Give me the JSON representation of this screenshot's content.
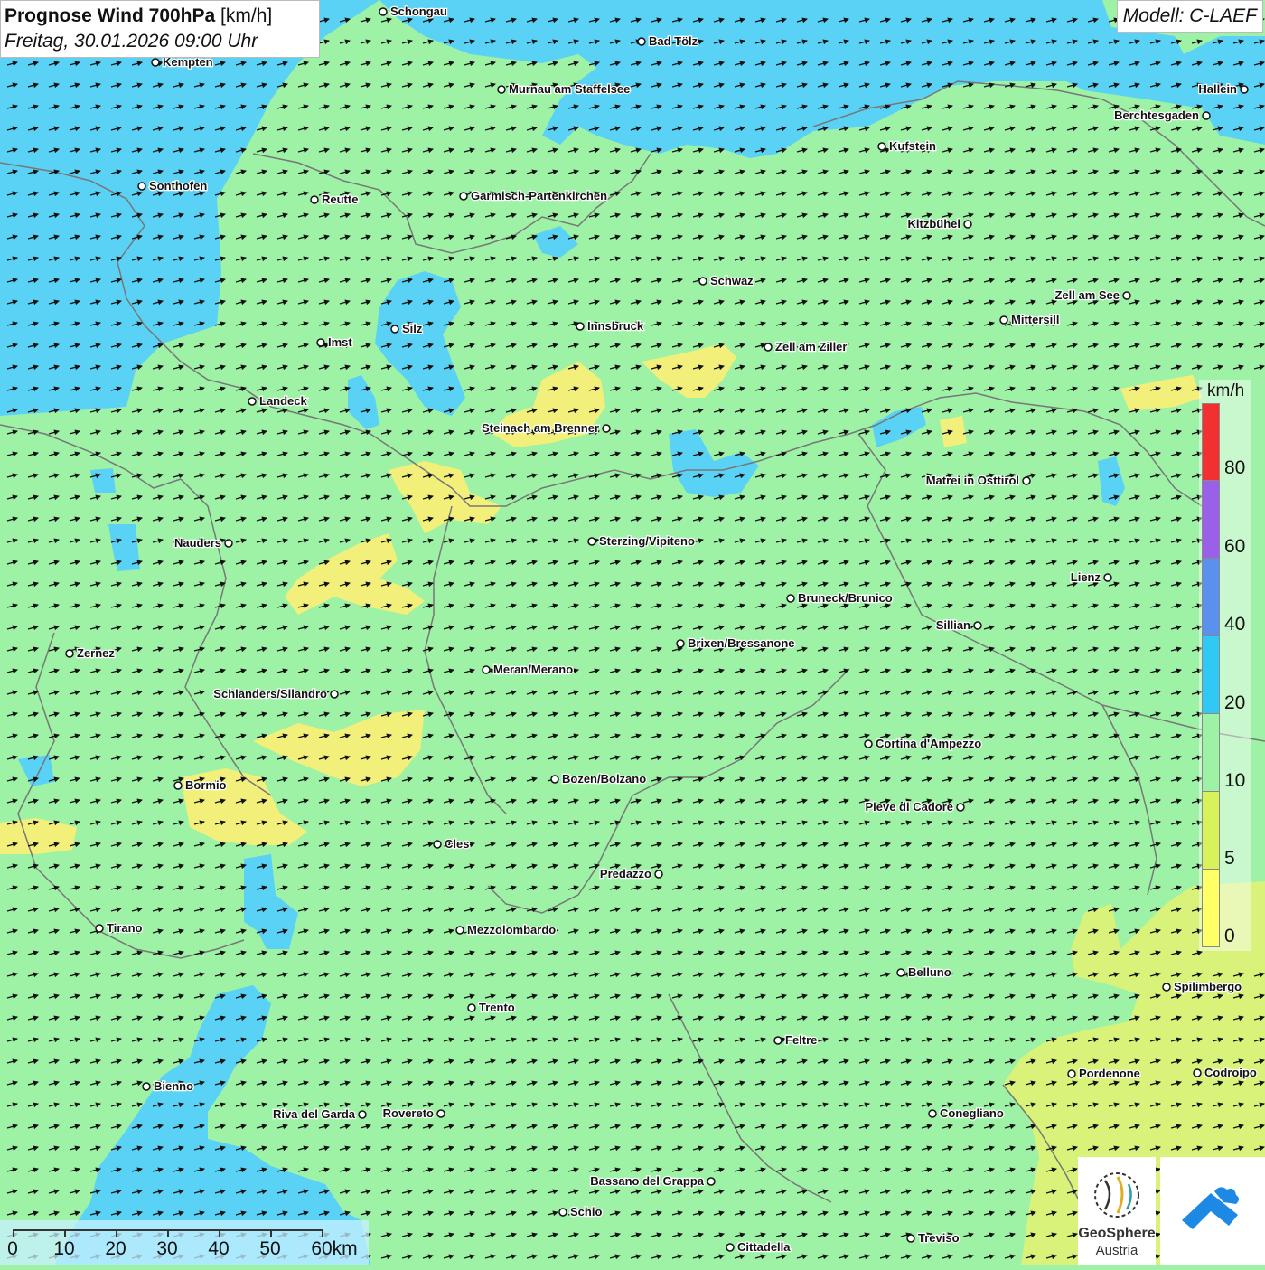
{
  "title": {
    "main": "Prognose Wind 700hPa",
    "unit": "[km/h]",
    "date": "Freitag, 30.01.2026 09:00 Uhr"
  },
  "model": "Modell: C-LAEF",
  "legend": {
    "unit": "km/h",
    "ticks": [
      "80",
      "60",
      "40",
      "20",
      "10",
      "5",
      "0"
    ],
    "colors": [
      "#f23030",
      "#9a60e8",
      "#5a90ee",
      "#30c8f4",
      "#9ef2a6",
      "#d8f25a",
      "#ffff66"
    ]
  },
  "colors": {
    "calm_yellow": "#f2f07a",
    "green": "#9ef2a6",
    "light_blue": "#5ad2f6",
    "yellow_green": "#d8f27a",
    "border": "#777777",
    "arrow": "#111111"
  },
  "wind": {
    "direction_label": "WSW",
    "arrow_glyph": "➝"
  },
  "cities": [
    {
      "name": "Schongau"
    },
    {
      "name": "Bad Tölz"
    },
    {
      "name": "Kempten"
    },
    {
      "name": "Murnau am Staffelsee"
    },
    {
      "name": "Hallein"
    },
    {
      "name": "Berchtesgaden"
    },
    {
      "name": "Kufstein"
    },
    {
      "name": "Sonthofen"
    },
    {
      "name": "Reutte"
    },
    {
      "name": "Garmisch-Partenkirchen"
    },
    {
      "name": "Kitzbühel"
    },
    {
      "name": "Schwaz"
    },
    {
      "name": "Zell am See"
    },
    {
      "name": "Silz"
    },
    {
      "name": "Innsbruck"
    },
    {
      "name": "Mittersill"
    },
    {
      "name": "Imst"
    },
    {
      "name": "Zell am Ziller"
    },
    {
      "name": "Landeck"
    },
    {
      "name": "Steinach am Brenner"
    },
    {
      "name": "Matrei in Osttirol"
    },
    {
      "name": "Nauders"
    },
    {
      "name": "Sterzing/Vipiteno"
    },
    {
      "name": "Lienz"
    },
    {
      "name": "Bruneck/Brunico"
    },
    {
      "name": "Sillian"
    },
    {
      "name": "Brixen/Bressanone"
    },
    {
      "name": "Zernez"
    },
    {
      "name": "Meran/Merano"
    },
    {
      "name": "Schlanders/Silandro"
    },
    {
      "name": "Cortina d'Ampezzo"
    },
    {
      "name": "Bozen/Bolzano"
    },
    {
      "name": "Bormio"
    },
    {
      "name": "Pieve di Cadore"
    },
    {
      "name": "Cles"
    },
    {
      "name": "Predazzo"
    },
    {
      "name": "Tirano"
    },
    {
      "name": "Mezzolombardo"
    },
    {
      "name": "Belluno"
    },
    {
      "name": "Spilimbergo"
    },
    {
      "name": "Trento"
    },
    {
      "name": "Feltre"
    },
    {
      "name": "Pordenone"
    },
    {
      "name": "Codroipo"
    },
    {
      "name": "Bienno"
    },
    {
      "name": "Riva del Garda"
    },
    {
      "name": "Rovereto"
    },
    {
      "name": "Conegliano"
    },
    {
      "name": "Bassano del Grappa"
    },
    {
      "name": "Schio"
    },
    {
      "name": "Treviso"
    },
    {
      "name": "Cittadella"
    }
  ],
  "scale": {
    "labels": [
      "0",
      "10",
      "20",
      "30",
      "40",
      "50",
      "60km"
    ]
  },
  "logos": {
    "geosphere_line1": "GeoSphere",
    "geosphere_line2": "Austria"
  }
}
